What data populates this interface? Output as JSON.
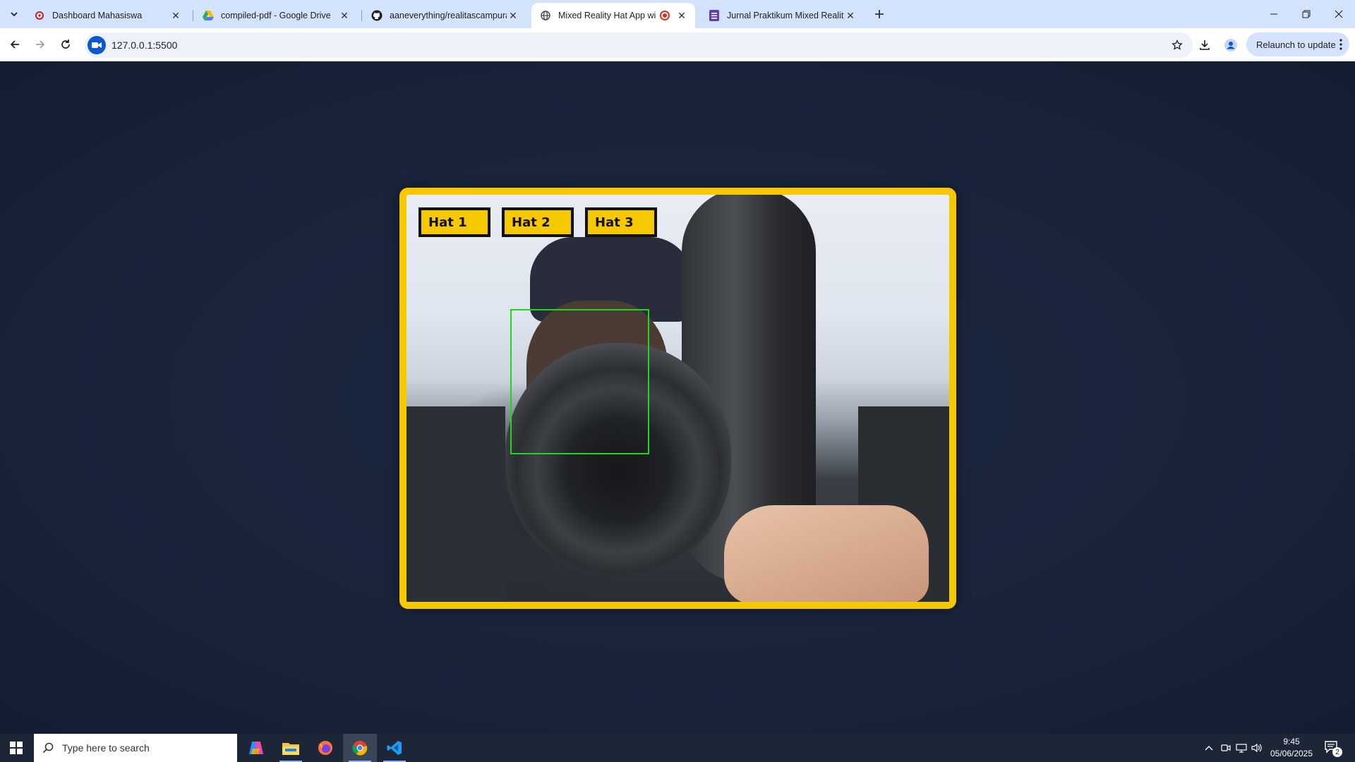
{
  "browser": {
    "tabs": [
      {
        "title": "Dashboard Mahasiswa",
        "icon": "gear-favicon-icon",
        "active": false
      },
      {
        "title": "compiled-pdf - Google Drive",
        "icon": "google-drive-icon",
        "active": false
      },
      {
        "title": "aaneverything/realitascampuran",
        "icon": "github-icon",
        "active": false
      },
      {
        "title": "Mixed Reality Hat App with",
        "icon": "globe-icon",
        "active": true,
        "recording": true
      },
      {
        "title": "Jurnal Praktikum Mixed Reality",
        "icon": "forms-icon",
        "active": false
      }
    ],
    "url": "127.0.0.1:5500",
    "relaunch_label": "Relaunch to update"
  },
  "app": {
    "hat_buttons": [
      {
        "label": "Hat 1"
      },
      {
        "label": "Hat 2"
      },
      {
        "label": "Hat 3"
      }
    ],
    "frame_color": "#f5c800",
    "face_box_color": "#22d61e"
  },
  "taskbar": {
    "search_placeholder": "Type here to search",
    "apps": [
      "copilot-icon",
      "file-explorer-icon",
      "firefox-icon",
      "chrome-icon",
      "vscode-icon"
    ],
    "time": "9:45",
    "date": "05/06/2025",
    "notification_count": "2"
  }
}
